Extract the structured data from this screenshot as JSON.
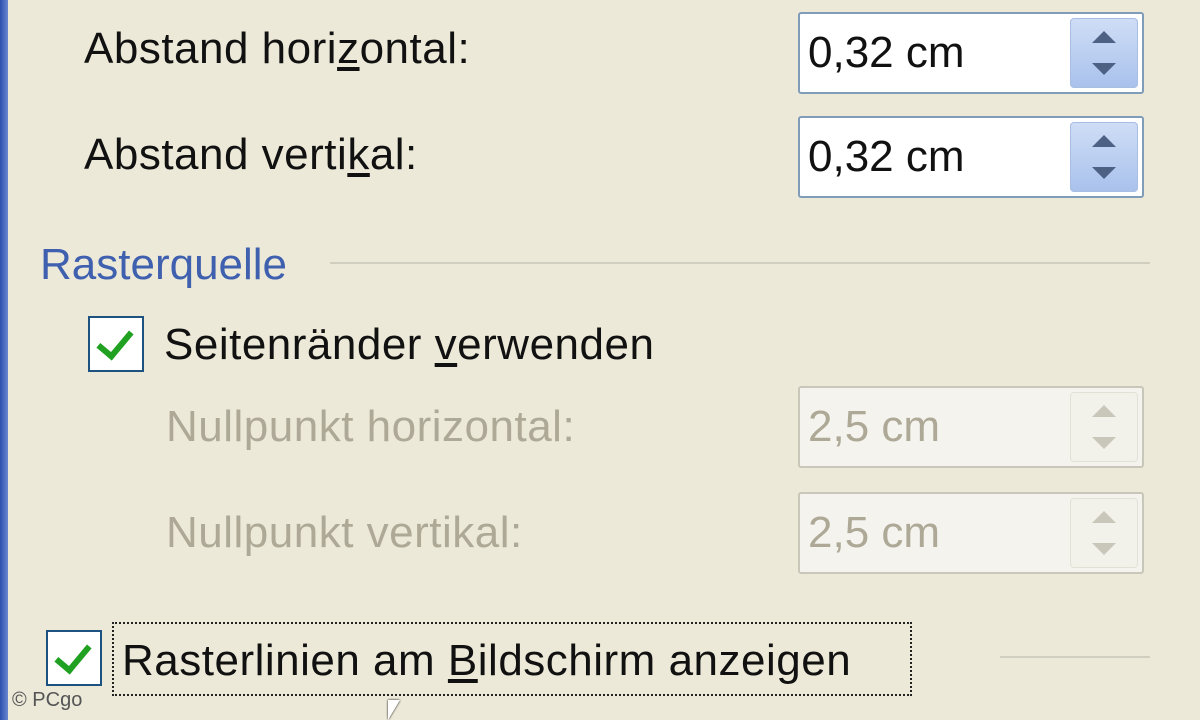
{
  "grid": {
    "horizontal_spacing": {
      "label_pre": "Abstand hori",
      "label_u": "z",
      "label_post": "ontal:",
      "value": "0,32 cm"
    },
    "vertical_spacing": {
      "label_pre": "Abstand verti",
      "label_u": "k",
      "label_post": "al:",
      "value": "0,32 cm"
    }
  },
  "grid_source": {
    "title": "Rasterquelle",
    "use_margins": {
      "label_pre": "Seitenränder ",
      "label_u": "v",
      "label_post": "erwenden",
      "checked": true
    },
    "origin_horizontal": {
      "label": "Nullpunkt horizontal:",
      "value": "2,5 cm",
      "disabled": true
    },
    "origin_vertical": {
      "label": "Nullpunkt vertikal:",
      "value": "2,5 cm",
      "disabled": true
    }
  },
  "show_gridlines": {
    "label_pre": "Rasterlinien am ",
    "label_u": "B",
    "label_post": "ildschirm anzeigen",
    "checked": true
  },
  "watermark": "© PCgo"
}
